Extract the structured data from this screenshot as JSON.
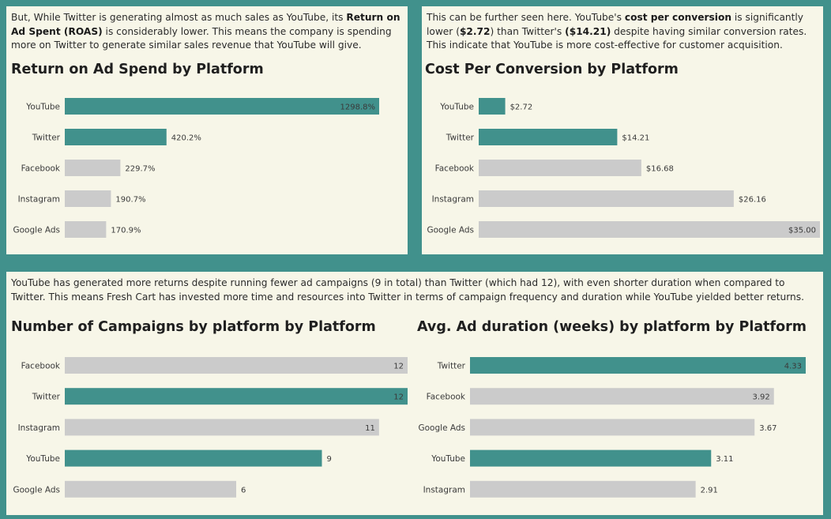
{
  "colors": {
    "background": "#41918c",
    "panel": "#f7f6e8",
    "highlight_bar": "#41918c",
    "other_bar": "#cbcbcb"
  },
  "panels": {
    "roas": {
      "para": [
        {
          "t": "But, While Twitter is generating almost as much sales as YouTube, its ",
          "b": false
        },
        {
          "t": "Return on Ad Spent (ROAS)",
          "b": true
        },
        {
          "t": " is considerably lower. This means the company is spending more on Twitter to generate similar sales revenue that YouTube will give.",
          "b": false
        }
      ]
    },
    "cpc": {
      "para": [
        {
          "t": "This can be further seen here. YouTube's ",
          "b": false
        },
        {
          "t": "cost per conversion",
          "b": true
        },
        {
          "t": " is significantly lower (",
          "b": false
        },
        {
          "t": "$2.72",
          "b": true
        },
        {
          "t": ") than Twitter's ",
          "b": false
        },
        {
          "t": "($14.21)",
          "b": true
        },
        {
          "t": " despite having similar conversion rates. This indicate that YouTube is more cost-effective for customer acquisition.",
          "b": false
        }
      ]
    },
    "bottom": {
      "para": [
        {
          "t": "YouTube has generated more returns despite running fewer ad campaigns (9 in total) than Twitter (which had 12), with even shorter duration when compared to Twitter. This means Fresh Cart has invested more time and resources into Twitter in terms of campaign frequency and duration while YouTube yielded better returns.",
          "b": false
        }
      ]
    }
  },
  "chart_data": [
    {
      "type": "bar",
      "orientation": "horizontal",
      "title": "Return on Ad Spend by Platform",
      "categories": [
        "YouTube",
        "Twitter",
        "Facebook",
        "Instagram",
        "Google Ads"
      ],
      "values": [
        1298.8,
        420.2,
        229.7,
        190.7,
        170.9
      ],
      "labels": [
        "1298.8%",
        "420.2%",
        "229.7%",
        "190.7%",
        "170.9%"
      ],
      "highlight": [
        "YouTube",
        "Twitter"
      ],
      "xlim": [
        0,
        1298.8
      ],
      "grid": false
    },
    {
      "type": "bar",
      "orientation": "horizontal",
      "title": "Cost Per Conversion by Platform",
      "categories": [
        "YouTube",
        "Twitter",
        "Facebook",
        "Instagram",
        "Google Ads"
      ],
      "values": [
        2.72,
        14.21,
        16.68,
        26.16,
        35.0
      ],
      "labels": [
        "$2.72",
        "$14.21",
        "$16.68",
        "$26.16",
        "$35.00"
      ],
      "highlight": [
        "YouTube",
        "Twitter"
      ],
      "xlim": [
        0,
        35.0
      ],
      "grid": false
    },
    {
      "type": "bar",
      "orientation": "horizontal",
      "title": "Number of Campaigns by platform by Platform",
      "categories": [
        "Facebook",
        "Twitter",
        "Instagram",
        "YouTube",
        "Google Ads"
      ],
      "values": [
        12,
        12,
        11,
        9,
        6
      ],
      "labels": [
        "12",
        "12",
        "11",
        "9",
        "6"
      ],
      "highlight": [
        "YouTube",
        "Twitter"
      ],
      "xlim": [
        0,
        12
      ],
      "grid": false
    },
    {
      "type": "bar",
      "orientation": "horizontal",
      "title": "Avg. Ad duration (weeks) by platform by Platform",
      "categories": [
        "Twitter",
        "Facebook",
        "Google Ads",
        "YouTube",
        "Instagram"
      ],
      "values": [
        4.33,
        3.92,
        3.67,
        3.11,
        2.91
      ],
      "labels": [
        "4.33",
        "3.92",
        "3.67",
        "3.11",
        "2.91"
      ],
      "highlight": [
        "YouTube",
        "Twitter"
      ],
      "xlim": [
        0,
        4.33
      ],
      "grid": false
    }
  ]
}
